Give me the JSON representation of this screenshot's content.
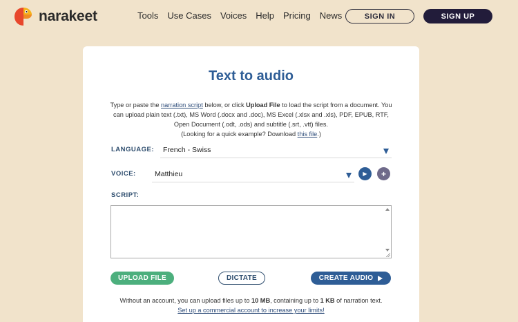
{
  "header": {
    "brand": "narakeet",
    "nav": [
      "Tools",
      "Use Cases",
      "Voices",
      "Help",
      "Pricing",
      "News"
    ],
    "sign_in": "SIGN IN",
    "sign_up": "SIGN UP"
  },
  "card": {
    "title": "Text to audio",
    "intro": {
      "p1": "Type or paste the ",
      "link1": "narration script",
      "p2": " below, or click ",
      "bold1": "Upload File",
      "p3": " to load the script from a document. You can upload plain text (.txt), MS Word (.docx and .doc), MS Excel (.xlsx and .xls), PDF, EPUB, RTF, Open Document (.odt, .ods) and subtitle (.srt, .vtt) files.",
      "p4": "(Looking for a quick example? Download ",
      "link2": "this file",
      "p5": ".)"
    },
    "language": {
      "label": "LANGUAGE:",
      "value": "French - Swiss"
    },
    "voice": {
      "label": "VOICE:",
      "value": "Matthieu"
    },
    "script": {
      "label": "SCRIPT:",
      "value": ""
    },
    "buttons": {
      "upload": "UPLOAD FILE",
      "dictate": "DICTATE",
      "create": "CREATE AUDIO"
    },
    "footnote": {
      "p1": "Without an account, you can upload files up to ",
      "b1": "10 MB",
      "p2": ", containing up to ",
      "b2": "1 KB",
      "p3": " of narration text.",
      "link": "Set up a commercial account to increase your limits!"
    }
  },
  "colors": {
    "background": "#f1e3cb",
    "primary": "#2e5d96",
    "upload_green": "#4caf7d",
    "signup_dark": "#221c3a"
  },
  "icons": {
    "logo": "parrot-logo-icon",
    "play": "play-icon",
    "add": "plus-icon",
    "dropdown": "chevron-down-icon",
    "create": "play-triangle-icon"
  }
}
